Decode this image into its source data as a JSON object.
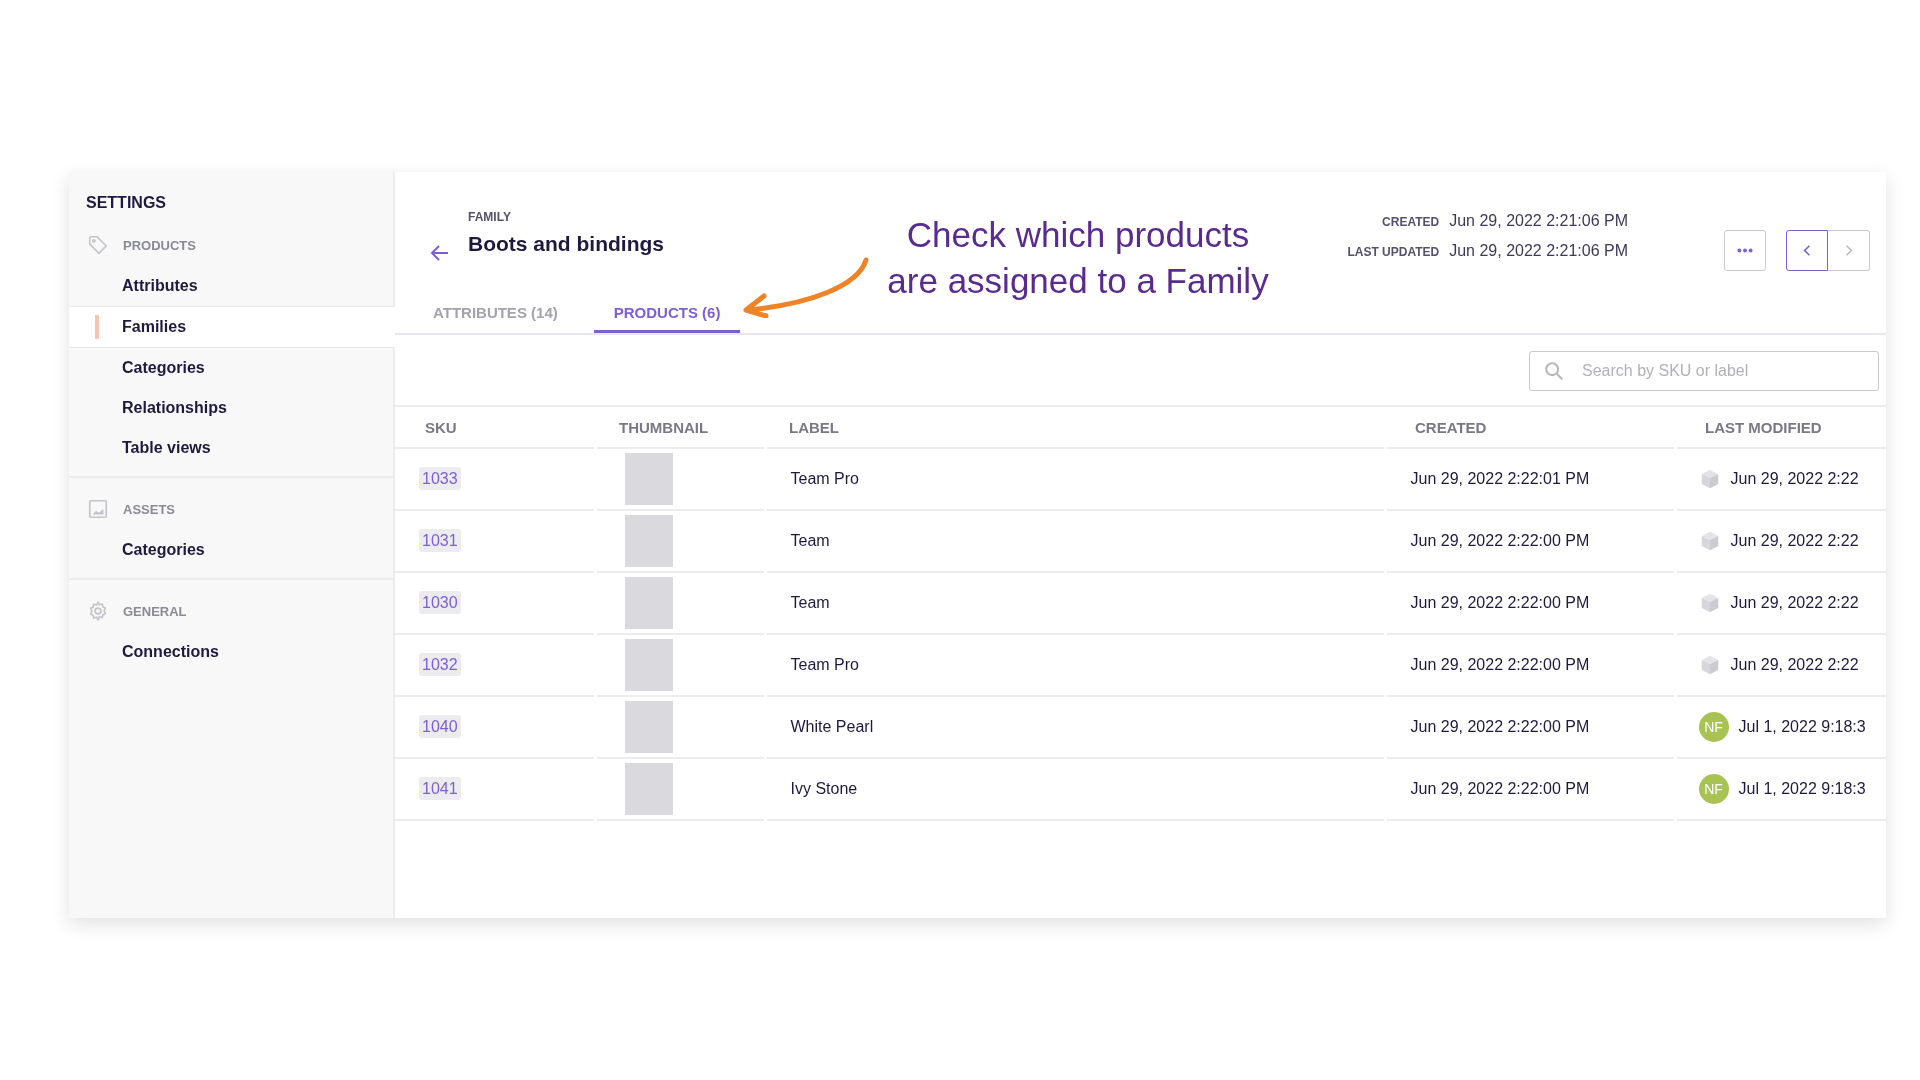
{
  "sidebar": {
    "title": "SETTINGS",
    "sections": [
      {
        "kind": "products",
        "heading": "PRODUCTS",
        "items": [
          {
            "label": "Attributes",
            "selected": false
          },
          {
            "label": "Families",
            "selected": true
          },
          {
            "label": "Categories",
            "selected": false
          },
          {
            "label": "Relationships",
            "selected": false
          },
          {
            "label": "Table views",
            "selected": false
          }
        ]
      },
      {
        "kind": "assets",
        "heading": "ASSETS",
        "items": [
          {
            "label": "Categories",
            "selected": false
          }
        ]
      },
      {
        "kind": "general",
        "heading": "GENERAL",
        "items": [
          {
            "label": "Connections",
            "selected": false
          }
        ]
      }
    ]
  },
  "header": {
    "eyebrow": "FAMILY",
    "title": "Boots and bindings",
    "created_label": "CREATED",
    "created": "Jun 29, 2022 2:21:06 PM",
    "updated_label": "LAST UPDATED",
    "updated": "Jun 29, 2022 2:21:06 PM"
  },
  "pager": {
    "previous_disabled": false,
    "next_disabled": true
  },
  "annotation": {
    "lines": [
      "Check which products",
      "are assigned to a Family"
    ]
  },
  "tabs": [
    {
      "label": "ATTRIBUTES (14)",
      "selected": false
    },
    {
      "label": "PRODUCTS (6)",
      "selected": true
    }
  ],
  "search": {
    "placeholder": "Search by SKU or label"
  },
  "table": {
    "columns": [
      "SKU",
      "THUMBNAIL",
      "LABEL",
      "CREATED",
      "LAST MODIFIED"
    ],
    "rows": [
      {
        "sku": "1033",
        "label": "Team Pro",
        "created": "Jun 29, 2022 2:22:01 PM",
        "modifier": {
          "kind": "system"
        },
        "modified": "Jun 29, 2022 2:22"
      },
      {
        "sku": "1031",
        "label": "Team",
        "created": "Jun 29, 2022 2:22:00 PM",
        "modifier": {
          "kind": "system"
        },
        "modified": "Jun 29, 2022 2:22"
      },
      {
        "sku": "1030",
        "label": "Team",
        "created": "Jun 29, 2022 2:22:00 PM",
        "modifier": {
          "kind": "system"
        },
        "modified": "Jun 29, 2022 2:22"
      },
      {
        "sku": "1032",
        "label": "Team Pro",
        "created": "Jun 29, 2022 2:22:00 PM",
        "modifier": {
          "kind": "system"
        },
        "modified": "Jun 29, 2022 2:22"
      },
      {
        "sku": "1040",
        "label": "White Pearl",
        "created": "Jun 29, 2022 2:22:00 PM",
        "modifier": {
          "kind": "user",
          "initials": "NF",
          "color": "#a9c254"
        },
        "modified": "Jul 1, 2022 9:18:3"
      },
      {
        "sku": "1041",
        "label": "Ivy Stone",
        "created": "Jun 29, 2022 2:22:00 PM",
        "modifier": {
          "kind": "user",
          "initials": "NF",
          "color": "#a9c254"
        },
        "modified": "Jul 1, 2022 9:18:3"
      }
    ]
  }
}
